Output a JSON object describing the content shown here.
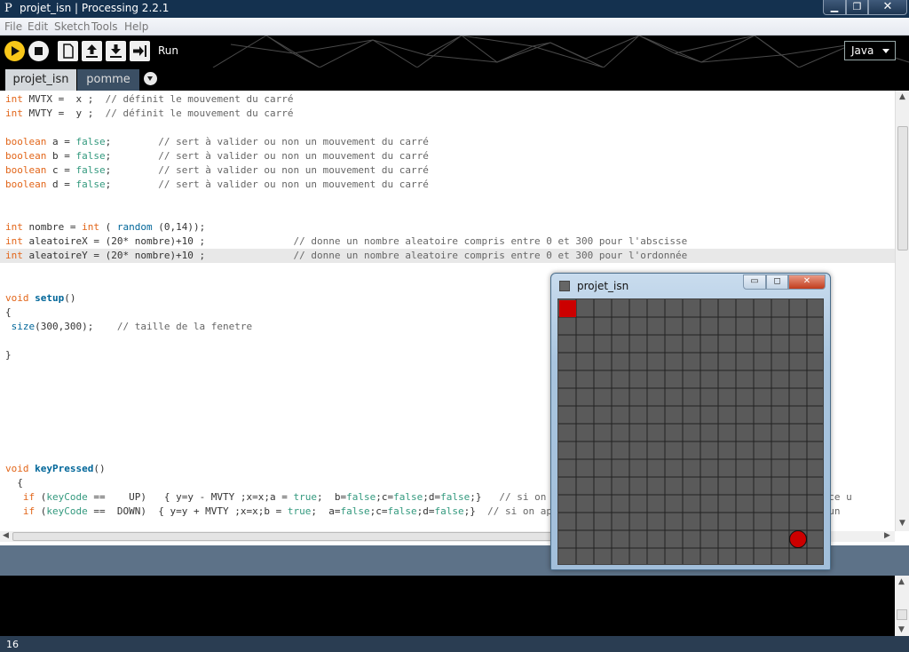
{
  "window": {
    "app_icon": "P",
    "title": "projet_isn | Processing 2.2.1",
    "buttons": {
      "minimize": "▁",
      "maximize": "❐",
      "close": "✕"
    }
  },
  "menu": [
    "File",
    "Edit",
    "Sketch",
    "Tools",
    "Help"
  ],
  "toolbar": {
    "buttons": [
      "run-icon",
      "stop-icon",
      "new-icon",
      "open-icon",
      "save-icon",
      "export-icon"
    ],
    "run_label": "Run",
    "mode": "Java"
  },
  "tabs": [
    "projet_isn",
    "pomme"
  ],
  "editor": {
    "highlighted_line": 11,
    "lines": [
      [
        [
          "t",
          "int"
        ],
        [
          "p",
          " MVTX =  x ;  "
        ],
        [
          "c",
          "// définit le mouvement du carré"
        ]
      ],
      [
        [
          "t",
          "int"
        ],
        [
          "p",
          " MVTY =  y ;  "
        ],
        [
          "c",
          "// définit le mouvement du carré"
        ]
      ],
      [],
      [
        [
          "t",
          "boolean"
        ],
        [
          "p",
          " a = "
        ],
        [
          "l",
          "false"
        ],
        [
          "p",
          ";        "
        ],
        [
          "c",
          "// sert à valider ou non un mouvement du carré"
        ]
      ],
      [
        [
          "t",
          "boolean"
        ],
        [
          "p",
          " b = "
        ],
        [
          "l",
          "false"
        ],
        [
          "p",
          ";        "
        ],
        [
          "c",
          "// sert à valider ou non un mouvement du carré"
        ]
      ],
      [
        [
          "t",
          "boolean"
        ],
        [
          "p",
          " c = "
        ],
        [
          "l",
          "false"
        ],
        [
          "p",
          ";        "
        ],
        [
          "c",
          "// sert à valider ou non un mouvement du carré"
        ]
      ],
      [
        [
          "t",
          "boolean"
        ],
        [
          "p",
          " d = "
        ],
        [
          "l",
          "false"
        ],
        [
          "p",
          ";        "
        ],
        [
          "c",
          "// sert à valider ou non un mouvement du carré"
        ]
      ],
      [],
      [],
      [
        [
          "t",
          "int"
        ],
        [
          "p",
          " nombre = "
        ],
        [
          "t",
          "int"
        ],
        [
          "p",
          " ( "
        ],
        [
          "f",
          "random"
        ],
        [
          "p",
          " (0,14));"
        ]
      ],
      [
        [
          "t",
          "int"
        ],
        [
          "p",
          " aleatoireX = (20* nombre)+10 ;               "
        ],
        [
          "c",
          "// donne un nombre aleatoire compris entre 0 et 300 pour l'abscisse"
        ]
      ],
      [
        [
          "t",
          "int"
        ],
        [
          "p",
          " aleatoireY = (20* nombre)+10 ;               "
        ],
        [
          "c",
          "// donne un nombre aleatoire compris entre 0 et 300 pour l'ordonnée"
        ]
      ],
      [],
      [],
      [
        [
          "t",
          "void"
        ],
        [
          "p",
          " "
        ],
        [
          "s",
          "setup"
        ],
        [
          "p",
          "()"
        ]
      ],
      [
        [
          "p",
          "{"
        ]
      ],
      [
        [
          "p",
          " "
        ],
        [
          "f",
          "size"
        ],
        [
          "p",
          "(300,300);    "
        ],
        [
          "c",
          "// taille de la fenetre"
        ]
      ],
      [],
      [
        [
          "p",
          "}"
        ]
      ],
      [],
      [],
      [],
      [],
      [],
      [],
      [],
      [
        [
          "t",
          "void"
        ],
        [
          "p",
          " "
        ],
        [
          "s",
          "keyPressed"
        ],
        [
          "p",
          "()"
        ]
      ],
      [
        [
          "p",
          "  {"
        ]
      ],
      [
        [
          "p",
          "   "
        ],
        [
          "t",
          "if"
        ],
        [
          "p",
          " ("
        ],
        [
          "l",
          "keyCode"
        ],
        [
          "p",
          " ==    UP)   { y=y - MVTY ;x=x;a = "
        ],
        [
          "l",
          "true"
        ],
        [
          "p",
          ";  b="
        ],
        [
          "l",
          "false"
        ],
        [
          "p",
          ";c="
        ],
        [
          "l",
          "false"
        ],
        [
          "p",
          ";d="
        ],
        [
          "l",
          "false"
        ],
        [
          "p",
          ";}   "
        ],
        [
          "c",
          "// si on appuie sur la touche du haut, le carré se déplace u"
        ]
      ],
      [
        [
          "p",
          "   "
        ],
        [
          "t",
          "if"
        ],
        [
          "p",
          " ("
        ],
        [
          "l",
          "keyCode"
        ],
        [
          "p",
          " ==  DOWN)  { y=y + MVTY ;x=x;b = "
        ],
        [
          "l",
          "true"
        ],
        [
          "p",
          ";  a="
        ],
        [
          "l",
          "false"
        ],
        [
          "p",
          ";c="
        ],
        [
          "l",
          "false"
        ],
        [
          "p",
          ";d="
        ],
        [
          "l",
          "false"
        ],
        [
          "p",
          ";}  "
        ],
        [
          "c",
          "// si on appuie sur la touche du bas, le carré se déplace un"
        ]
      ]
    ]
  },
  "status": {
    "line_number": "16"
  },
  "sketch": {
    "title": "projet_isn",
    "buttons": {
      "minimize": "▭",
      "maximize": "◻",
      "close": "✕"
    },
    "grid_cells": 15,
    "background_color": "#5a5a5a",
    "grid_line_color": "#222222",
    "square": {
      "col": 0,
      "row": 0,
      "color": "#cc0000"
    },
    "apple": {
      "col": 13,
      "row": 13,
      "color": "#cc0000"
    }
  },
  "colors": {
    "accent_run": "#f8c719",
    "titlebar": "#14314f",
    "message_bar": "#5d7288"
  }
}
